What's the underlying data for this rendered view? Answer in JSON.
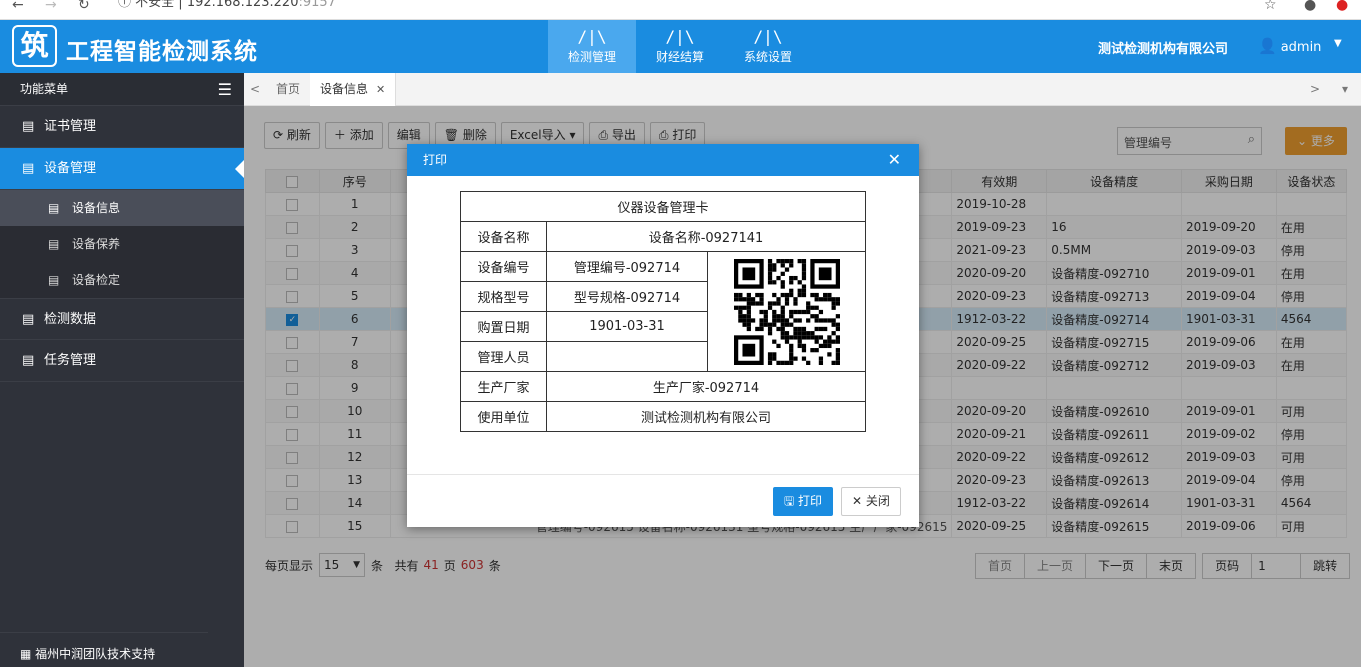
{
  "browser": {
    "security": "不安全",
    "url_host": "192.168.123.220",
    "url_port": ":9157"
  },
  "app": {
    "logo_char": "筑",
    "title": "工程智能检测系统",
    "company": "测试检测机构有限公司",
    "user": "admin"
  },
  "topnav": [
    {
      "label": "检测管理",
      "icon": "/|\\",
      "active": true
    },
    {
      "label": "财经结算",
      "icon": "/|\\"
    },
    {
      "label": "系统设置",
      "icon": "/|\\"
    }
  ],
  "sidebar": {
    "header": "功能菜单",
    "items": [
      {
        "label": "证书管理"
      },
      {
        "label": "设备管理",
        "active": true
      },
      {
        "label": "检测数据"
      },
      {
        "label": "任务管理"
      }
    ],
    "subitems": [
      {
        "label": "设备信息",
        "active": true
      },
      {
        "label": "设备保养"
      },
      {
        "label": "设备检定"
      }
    ],
    "footer": "福州中润团队技术支持"
  },
  "tabs": {
    "home": "首页",
    "current": "设备信息"
  },
  "toolbar": {
    "refresh": "刷新",
    "add": "添加",
    "edit": "编辑",
    "delete": "删除",
    "excel_import": "Excel导入",
    "export": "导出",
    "print": "打印",
    "search_placeholder": "管理编号",
    "more": "更多"
  },
  "grid": {
    "columns": [
      "序号",
      "有效期",
      "设备精度",
      "采购日期",
      "设备状态"
    ],
    "rows": [
      {
        "no": "1",
        "validity": "2019-10-28",
        "precision": "",
        "purchase": "",
        "status": ""
      },
      {
        "no": "2",
        "validity": "2019-09-23",
        "precision": "16",
        "purchase": "2019-09-20",
        "status": "在用"
      },
      {
        "no": "3",
        "validity": "2021-09-23",
        "precision": "0.5MM",
        "purchase": "2019-09-03",
        "status": "停用"
      },
      {
        "no": "4",
        "validity": "2020-09-20",
        "precision": "设备精度-092710",
        "purchase": "2019-09-01",
        "status": "在用"
      },
      {
        "no": "5",
        "validity": "2020-09-23",
        "precision": "设备精度-092713",
        "purchase": "2019-09-04",
        "status": "停用"
      },
      {
        "no": "6",
        "validity": "1912-03-22",
        "precision": "设备精度-092714",
        "purchase": "1901-03-31",
        "status": "4564",
        "selected": true
      },
      {
        "no": "7",
        "validity": "2020-09-25",
        "precision": "设备精度-092715",
        "purchase": "2019-09-06",
        "status": "在用"
      },
      {
        "no": "8",
        "validity": "2020-09-22",
        "precision": "设备精度-092712",
        "purchase": "2019-09-03",
        "status": "在用"
      },
      {
        "no": "9",
        "validity": "",
        "precision": "",
        "purchase": "",
        "status": ""
      },
      {
        "no": "10",
        "validity": "2020-09-20",
        "precision": "设备精度-092610",
        "purchase": "2019-09-01",
        "status": "可用"
      },
      {
        "no": "11",
        "validity": "2020-09-21",
        "precision": "设备精度-092611",
        "purchase": "2019-09-02",
        "status": "停用"
      },
      {
        "no": "12",
        "validity": "2020-09-22",
        "precision": "设备精度-092612",
        "purchase": "2019-09-03",
        "status": "可用"
      },
      {
        "no": "13",
        "validity": "2020-09-23",
        "precision": "设备精度-092613",
        "purchase": "2019-09-04",
        "status": "停用"
      },
      {
        "no": "14",
        "validity": "1912-03-22",
        "precision": "设备精度-092614",
        "purchase": "1901-03-31",
        "status": "4564"
      },
      {
        "no": "15",
        "validity": "2020-09-25",
        "precision": "设备精度-092615",
        "purchase": "2019-09-06",
        "status": "可用",
        "partial": "管理编号-092615     设备名称-0926131     型号规格-092615     生产厂家-092615"
      }
    ]
  },
  "pager": {
    "per_page_label": "每页显示",
    "per_page": "15",
    "unit": "条",
    "total_label": "共有",
    "total_pages": "41",
    "page_unit": "页",
    "total_records": "603",
    "records_unit": "条",
    "first": "首页",
    "prev": "上一页",
    "next": "下一页",
    "last": "末页",
    "page_label": "页码",
    "page_value": "1",
    "jump": "跳转"
  },
  "modal": {
    "title": "打印",
    "card_title": "仪器设备管理卡",
    "name_label": "设备名称",
    "name": "设备名称-0927141",
    "code_label": "设备编号",
    "code": "管理编号-092714",
    "model_label": "规格型号",
    "model": "型号规格-092714",
    "date_label": "购置日期",
    "date": "1901-03-31",
    "manager_label": "管理人员",
    "manager": "",
    "maker_label": "生产厂家",
    "maker": "生产厂家-092714",
    "unit_label": "使用单位",
    "unit": "测试检测机构有限公司",
    "print_btn": "打印",
    "close_btn": "关闭"
  }
}
